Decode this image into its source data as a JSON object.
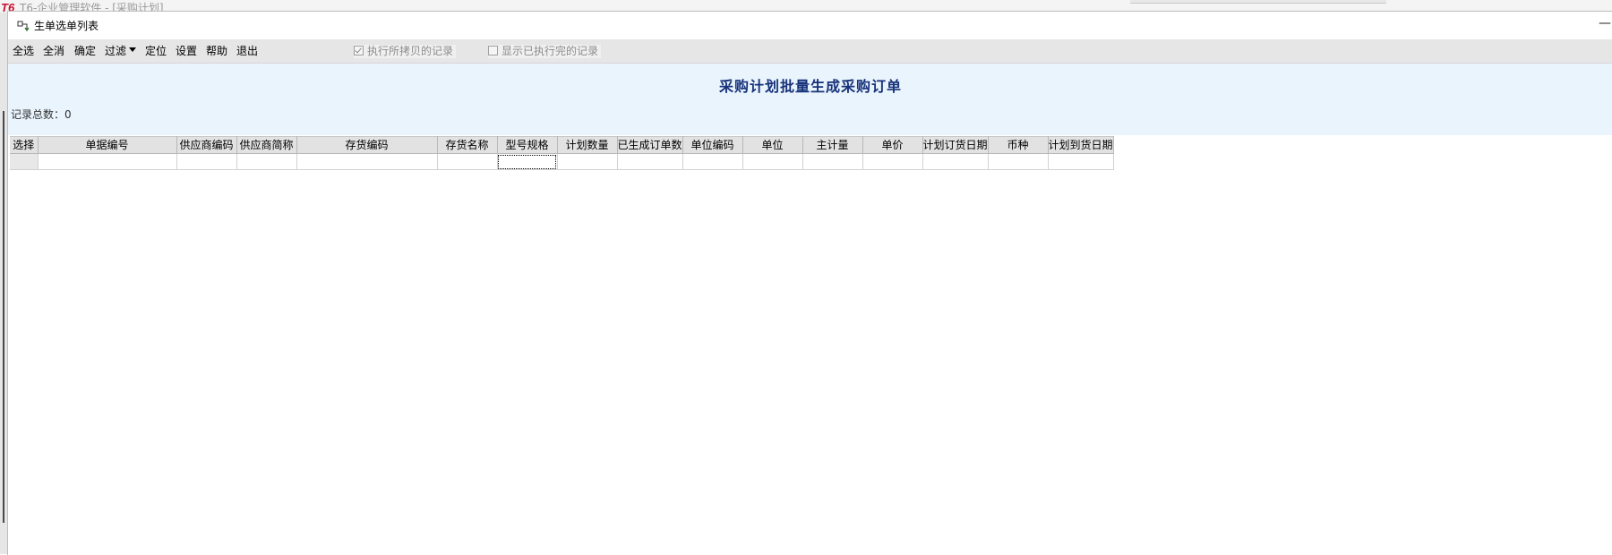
{
  "background": {
    "logo": "T6",
    "title": "T6-企业管理软件 - [采购计划]"
  },
  "window": {
    "title": "生单选单列表",
    "icon": "dialog-app-icon",
    "minimize_glyph": "—"
  },
  "toolbar": {
    "select_all": "全选",
    "deselect_all": "全消",
    "confirm": "确定",
    "filter": "过滤",
    "locate": "定位",
    "settings": "设置",
    "help": "帮助",
    "exit": "退出",
    "check_copied": {
      "label": "执行所拷贝的记录",
      "checked": true
    },
    "check_show_done": {
      "label": "显示已执行完的记录",
      "checked": false
    }
  },
  "header": {
    "title": "采购计划批量生成采购订单",
    "record_count": "记录总数：0"
  },
  "grid": {
    "columns": [
      "选择",
      "单据编号",
      "供应商编码",
      "供应商简称",
      "存货编码",
      "存货名称",
      "型号规格",
      "计划数量",
      "已生成订单数",
      "单位编码",
      "单位",
      "主计量",
      "单价",
      "计划订货日期",
      "币种",
      "计划到货日期"
    ],
    "rows": [
      [
        "",
        "",
        "",
        "",
        "",
        "",
        "",
        "",
        "",
        "",
        "",
        "",
        "",
        "",
        "",
        ""
      ]
    ]
  },
  "colors": {
    "title_text": "#17327a",
    "header_bg": "#eaf4fd",
    "toolbar_bg": "#e6e6e6",
    "logo_red": "#c8102e"
  }
}
